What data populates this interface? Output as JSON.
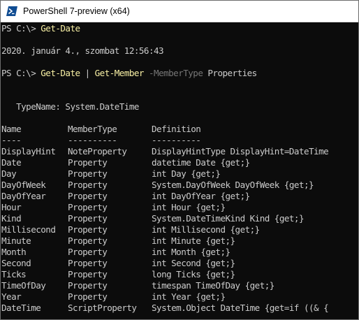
{
  "window": {
    "title": "PowerShell 7-preview (x64)"
  },
  "console": {
    "cmd1": {
      "prompt": "PS C:\\> ",
      "command": "Get-Date"
    },
    "output_date": "2020. január 4., szombat 12:56:43",
    "cmd2": {
      "prompt": "PS C:\\> ",
      "command1": "Get-Date",
      "pipe": " | ",
      "command2": "Get-Member",
      "param": " -MemberType",
      "arg": " Properties"
    },
    "typename": "   TypeName: System.DateTime",
    "headers": [
      "Name",
      "MemberType",
      "Definition"
    ],
    "separators": [
      "----",
      "----------",
      "----------"
    ],
    "rows": [
      [
        "DisplayHint",
        "NoteProperty",
        "DisplayHintType DisplayHint=DateTime"
      ],
      [
        "Date",
        "Property",
        "datetime Date {get;}"
      ],
      [
        "Day",
        "Property",
        "int Day {get;}"
      ],
      [
        "DayOfWeek",
        "Property",
        "System.DayOfWeek DayOfWeek {get;}"
      ],
      [
        "DayOfYear",
        "Property",
        "int DayOfYear {get;}"
      ],
      [
        "Hour",
        "Property",
        "int Hour {get;}"
      ],
      [
        "Kind",
        "Property",
        "System.DateTimeKind Kind {get;}"
      ],
      [
        "Millisecond",
        "Property",
        "int Millisecond {get;}"
      ],
      [
        "Minute",
        "Property",
        "int Minute {get;}"
      ],
      [
        "Month",
        "Property",
        "int Month {get;}"
      ],
      [
        "Second",
        "Property",
        "int Second {get;}"
      ],
      [
        "Ticks",
        "Property",
        "long Ticks {get;}"
      ],
      [
        "TimeOfDay",
        "Property",
        "timespan TimeOfDay {get;}"
      ],
      [
        "Year",
        "Property",
        "int Year {get;}"
      ],
      [
        "DateTime",
        "ScriptProperty",
        "System.Object DateTime {get=if ((& {"
      ]
    ]
  },
  "colors": {
    "background": "#0c0c0c",
    "text": "#cccccc",
    "command": "#f9f1a5",
    "parameter": "#767676"
  }
}
